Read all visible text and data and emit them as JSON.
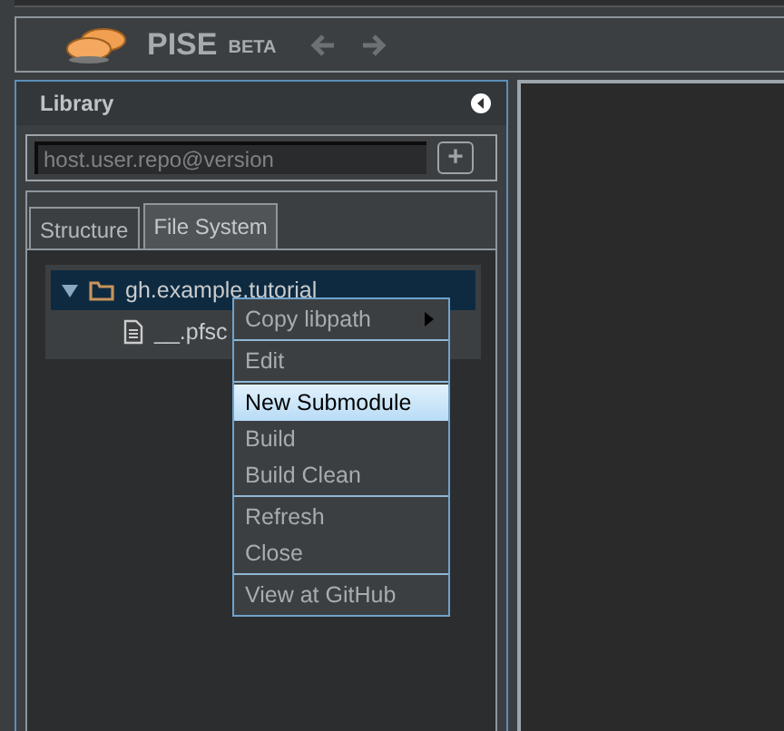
{
  "header": {
    "title": "PISE",
    "badge": "BETA"
  },
  "library": {
    "title": "Library",
    "search": {
      "placeholder": "host.user.repo@version"
    },
    "add_button": "+"
  },
  "tabs": [
    {
      "label": "Structure",
      "selected": false
    },
    {
      "label": "File System",
      "selected": true
    }
  ],
  "tree": [
    {
      "label": "gh.example.tutorial",
      "kind": "folder",
      "expanded": true,
      "selected": true,
      "children": [
        {
          "label": "__.pfsc",
          "kind": "file",
          "selected": false
        }
      ]
    }
  ],
  "context_menu": {
    "groups": [
      {
        "items": [
          {
            "label": "Copy libpath",
            "submenu": true,
            "selected": false
          }
        ]
      },
      {
        "items": [
          {
            "label": "Edit",
            "submenu": false,
            "selected": false
          }
        ]
      },
      {
        "items": [
          {
            "label": "New Submodule",
            "submenu": false,
            "selected": true
          },
          {
            "label": "Build",
            "submenu": false,
            "selected": false
          },
          {
            "label": "Build Clean",
            "submenu": false,
            "selected": false
          }
        ]
      },
      {
        "items": [
          {
            "label": "Refresh",
            "submenu": false,
            "selected": false
          },
          {
            "label": "Close",
            "submenu": false,
            "selected": false
          }
        ]
      },
      {
        "items": [
          {
            "label": "View at GitHub",
            "submenu": false,
            "selected": false
          }
        ]
      }
    ]
  }
}
